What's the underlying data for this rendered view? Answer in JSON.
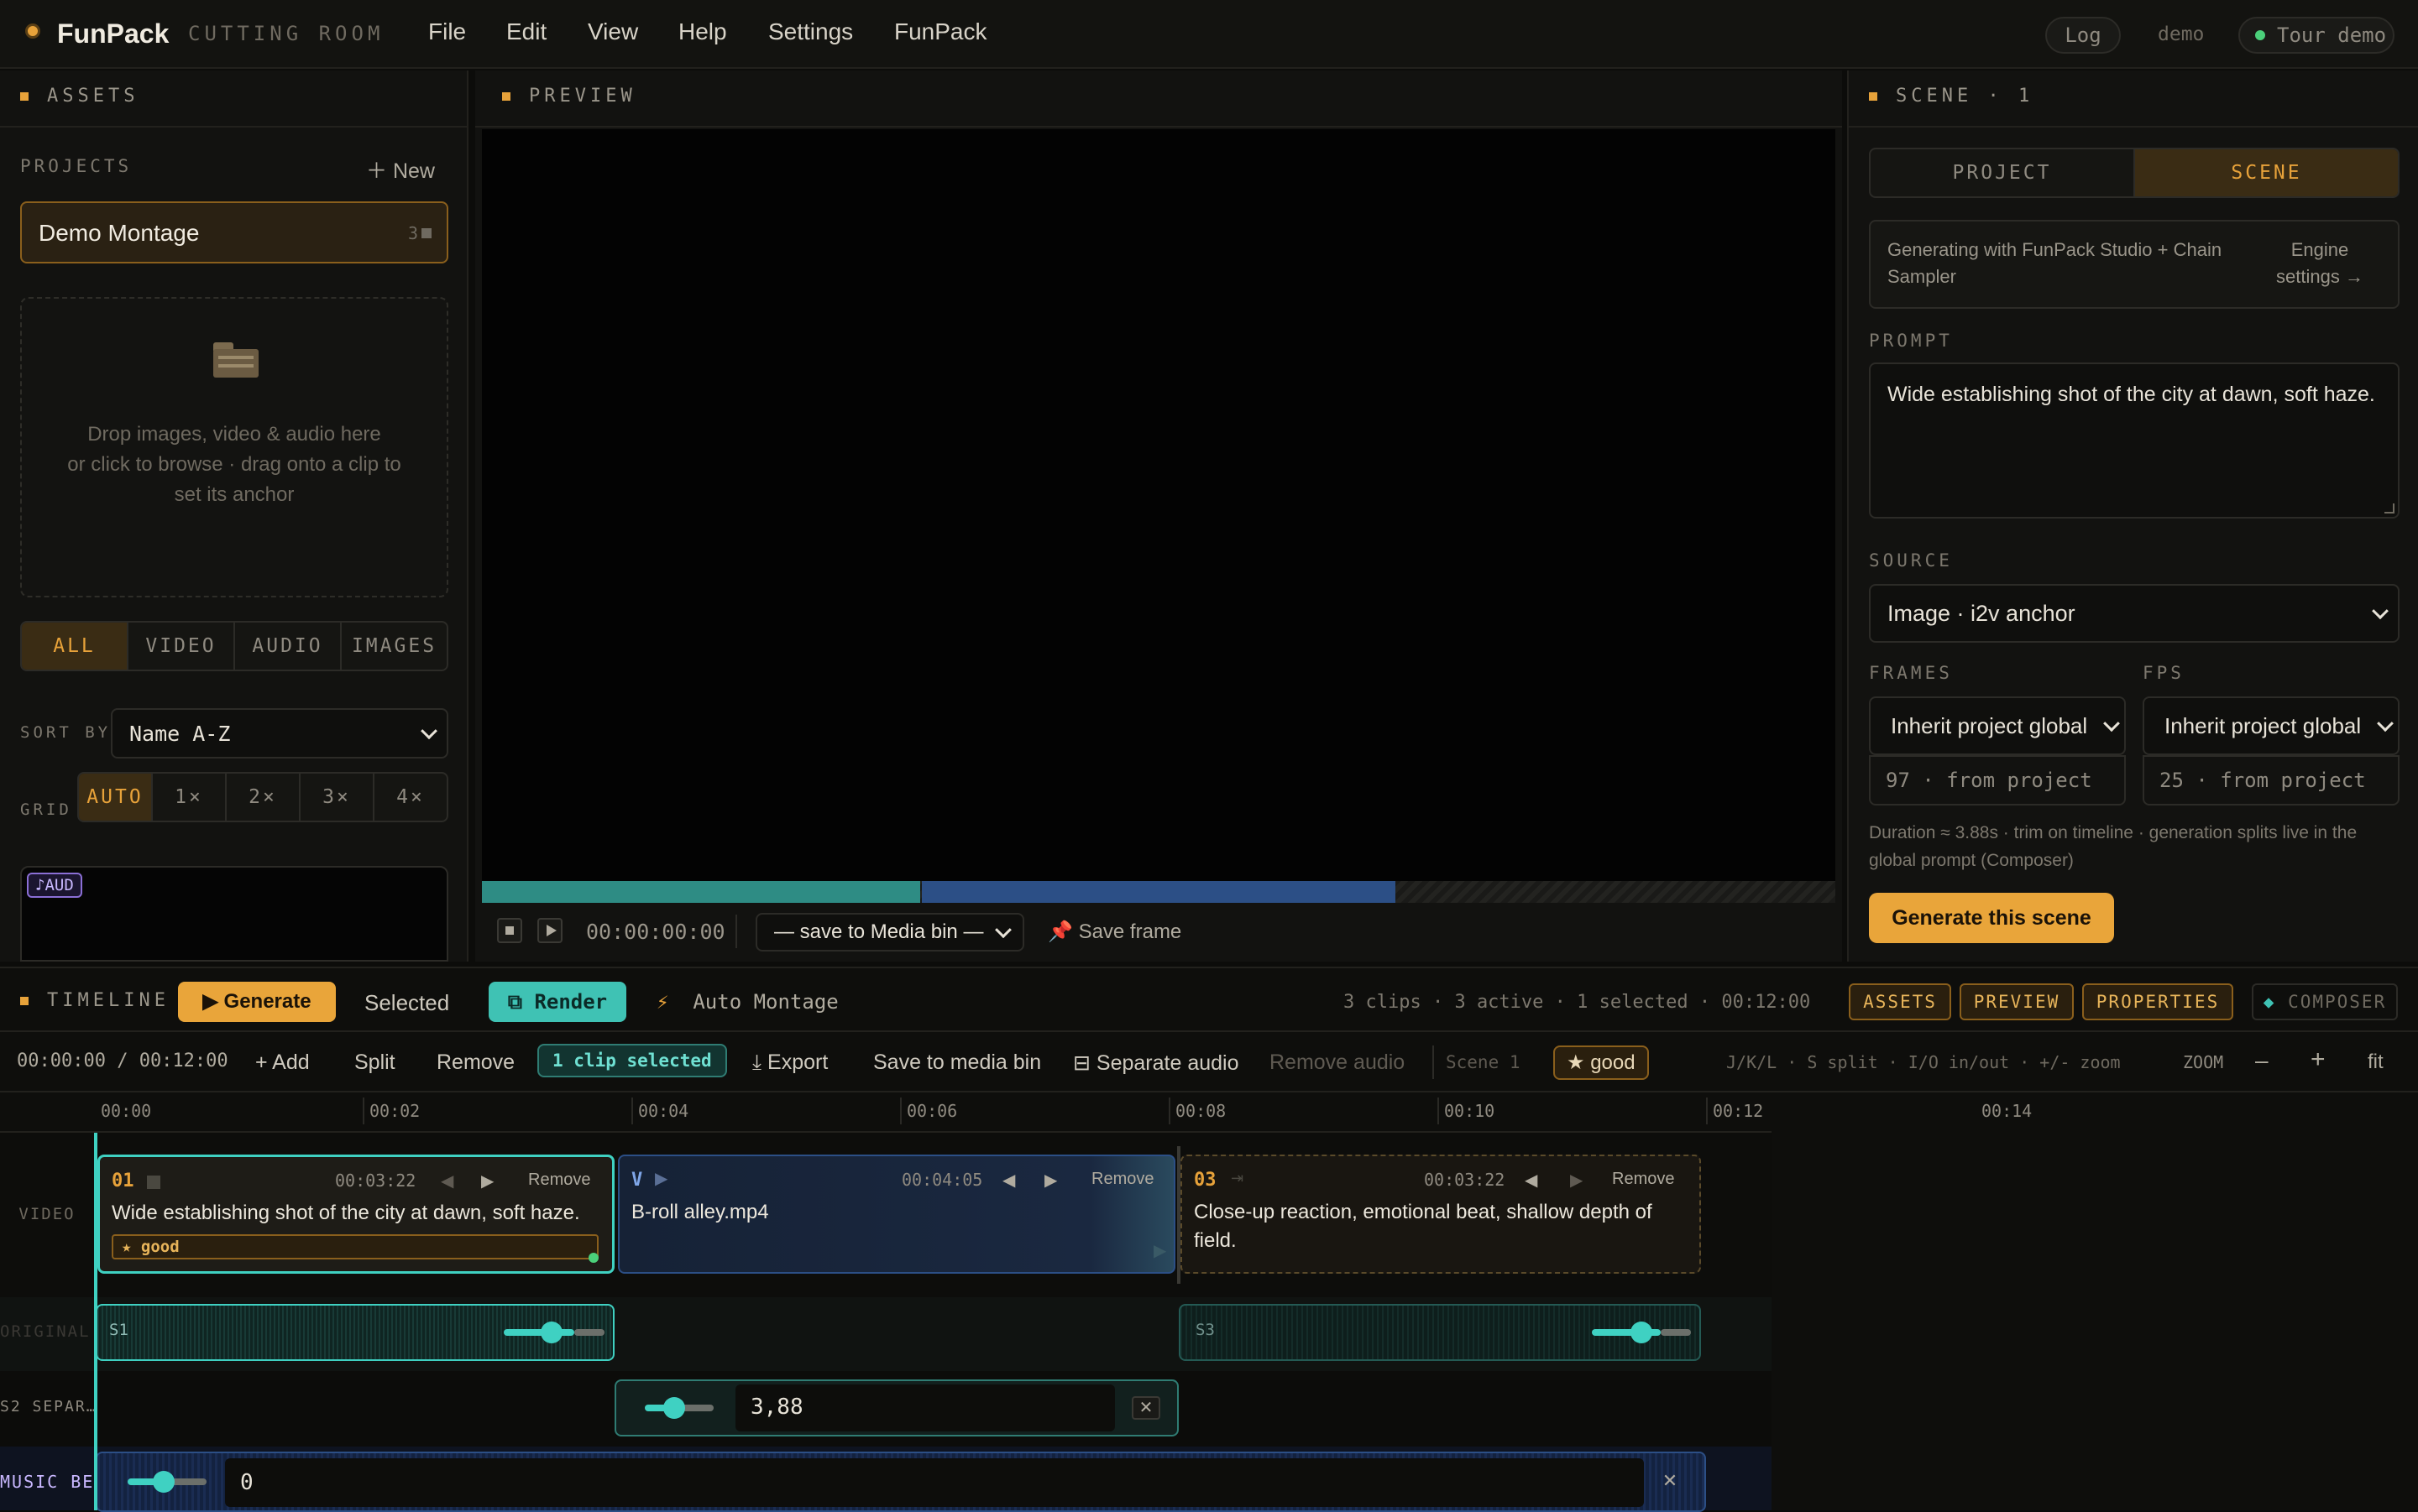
{
  "app": {
    "name": "FunPack",
    "subtitle": "CUTTING ROOM"
  },
  "menu": [
    "File",
    "Edit",
    "View",
    "Help",
    "Settings",
    "FunPack"
  ],
  "topright": {
    "log": "Log",
    "demo": "demo",
    "tour": "Tour demo"
  },
  "assets": {
    "title": "ASSETS",
    "projects_label": "PROJECTS",
    "new_label": "New",
    "project": {
      "name": "Demo Montage",
      "count": "3"
    },
    "drop": [
      "Drop images, video & audio here",
      "or click to browse · drag onto a clip to",
      "set its anchor"
    ],
    "filters": [
      "ALL",
      "VIDEO",
      "AUDIO",
      "IMAGES"
    ],
    "sort_label": "SORT BY",
    "sort_value": "Name A-Z",
    "grid_label": "GRID",
    "grid_opts": [
      "AUTO",
      "1×",
      "2×",
      "3×",
      "4×"
    ],
    "tile_badge": "♪AUD"
  },
  "preview": {
    "title": "PREVIEW",
    "timecode": "00:00:00:00",
    "save_select": "— save to Media bin —",
    "save_frame": "Save frame"
  },
  "scene": {
    "title": "SCENE · 1",
    "tabs": [
      "PROJECT",
      "SCENE"
    ],
    "engine_text": "Generating with FunPack Studio + Chain Sampler",
    "engine_link": "Engine settings →",
    "prompt_label": "PROMPT",
    "prompt": "Wide establishing shot of the city at dawn, soft haze.",
    "source_label": "SOURCE",
    "source": "Image · i2v anchor",
    "frames_label": "FRAMES",
    "fps_label": "FPS",
    "frames_select": "Inherit project global",
    "fps_select": "Inherit project global",
    "frames_value": "97 · from project",
    "fps_value": "25 · from project",
    "duration_note": "Duration ≈ 3.88s · trim on timeline · generation splits live in the global prompt (Composer)",
    "generate": "Generate this scene"
  },
  "timeline": {
    "title": "TIMELINE",
    "generate": "Generate",
    "selected": "Selected",
    "render": "Render",
    "auto": "Auto Montage",
    "stats": "3 clips · 3 active · 1 selected · 00:12:00",
    "view_btns": [
      "ASSETS",
      "PREVIEW",
      "PROPERTIES"
    ],
    "composer": "COMPOSER",
    "time": "00:00:00 / 00:12:00",
    "tools": {
      "add": "Add",
      "split": "Split",
      "remove": "Remove",
      "clip_sel": "1 clip selected",
      "export": "Export",
      "save_bin": "Save to media bin",
      "sep_audio": "Separate audio",
      "rm_audio": "Remove audio",
      "scene": "Scene 1",
      "good": "good"
    },
    "shortcuts": "J/K/L · S split · I/O in/out · +/- zoom",
    "zoom": "ZOOM",
    "minus": "–",
    "plus": "+",
    "fit": "fit",
    "ticks": [
      "00:00",
      "00:02",
      "00:04",
      "00:06",
      "00:08",
      "00:10",
      "00:12",
      "00:14"
    ],
    "rows": [
      "VIDEO",
      "ORIGINAL",
      "S2 SEPAR…",
      "MUSIC BE"
    ],
    "clips": [
      {
        "num": "01",
        "time": "00:03:22",
        "remove": "Remove",
        "title": "Wide establishing shot of the city at dawn, soft haze.",
        "tag": "★ good"
      },
      {
        "num": "V",
        "time": "00:04:05",
        "remove": "Remove",
        "title": "B-roll alley.mp4"
      },
      {
        "num": "03",
        "time": "00:03:22",
        "remove": "Remove",
        "title": "Close-up reaction, emotional beat, shallow depth of field."
      }
    ],
    "audio": {
      "s1": "S1",
      "s3": "S3",
      "sep_value": "3,88",
      "music_value": "0"
    }
  }
}
